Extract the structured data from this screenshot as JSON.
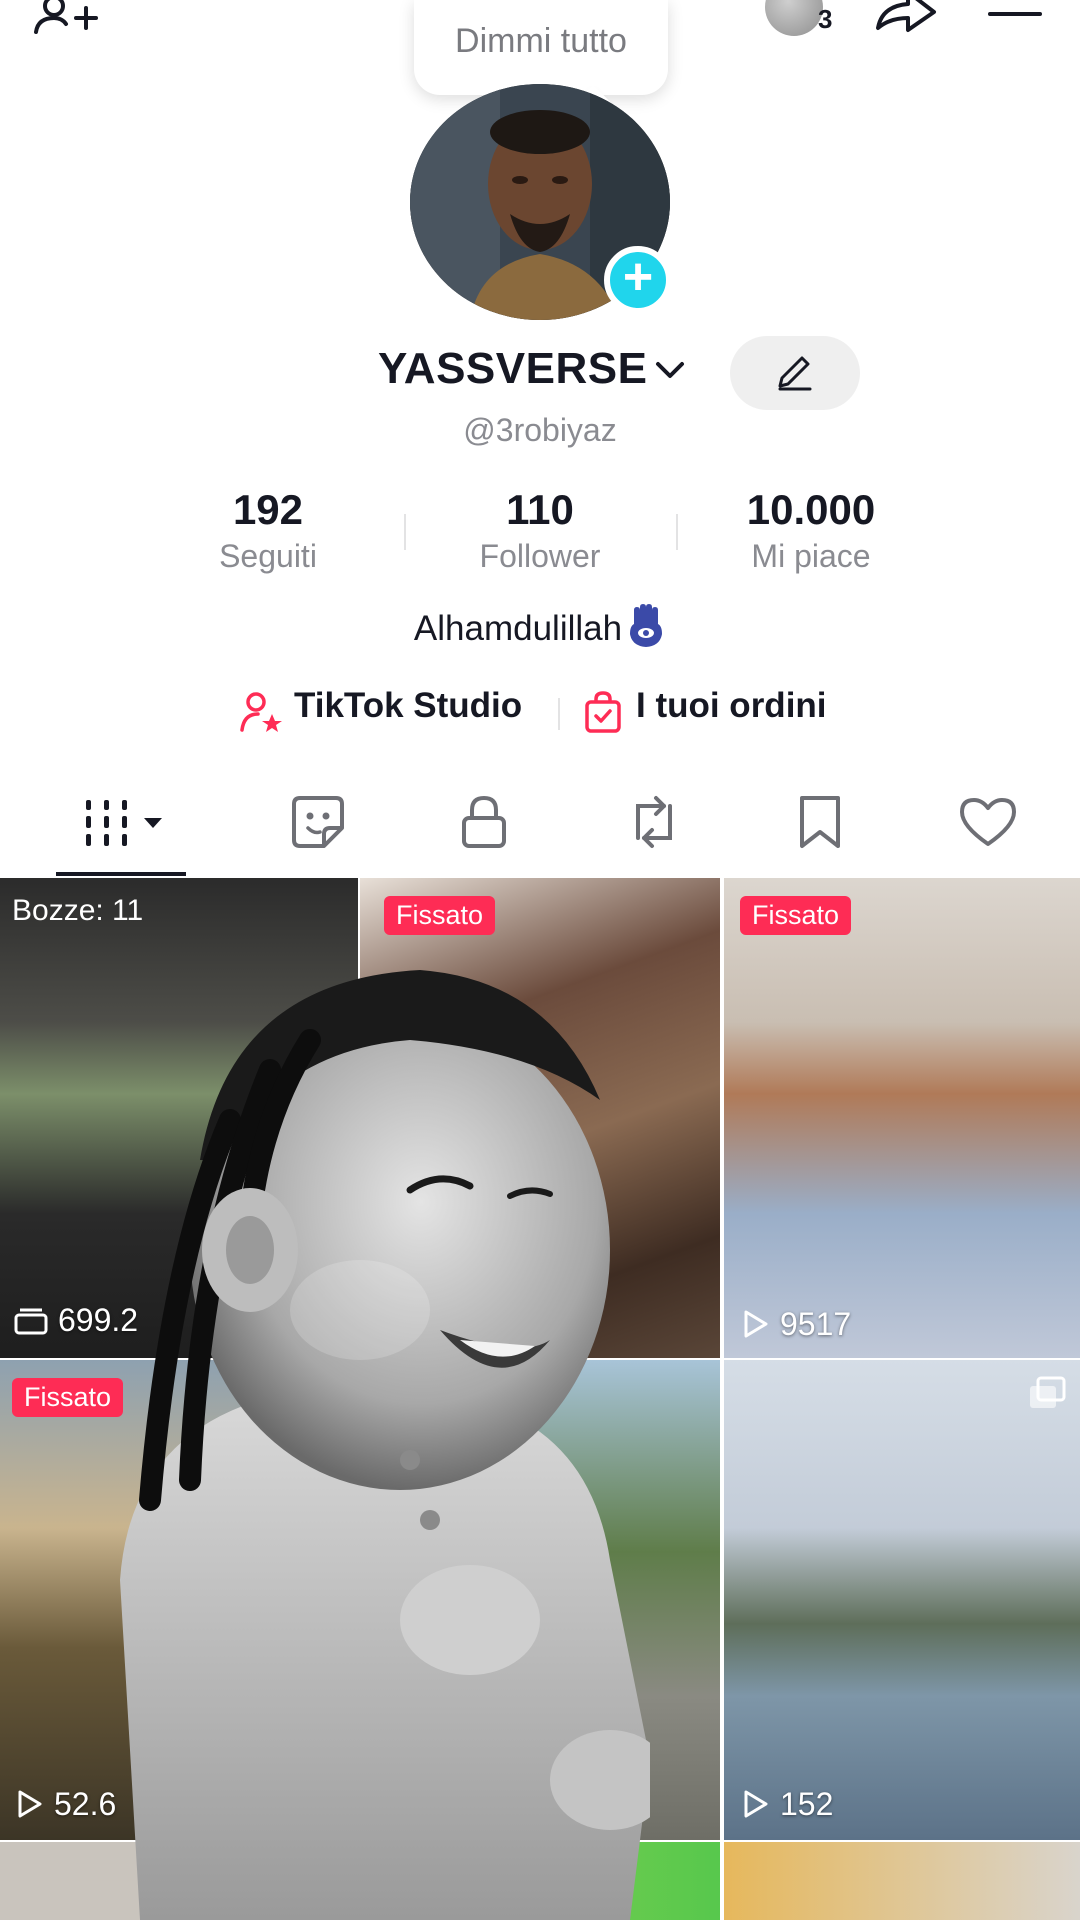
{
  "topbar": {
    "notification_count": "3"
  },
  "tooltip": {
    "text": "Dimmi tutto"
  },
  "profile": {
    "display_name": "YASSVERSE",
    "handle": "@3robiyaz",
    "bio": "Alhamdulillah"
  },
  "stats": [
    {
      "value": "192",
      "label": "Seguiti"
    },
    {
      "value": "110",
      "label": "Follower"
    },
    {
      "value": "10.000",
      "label": "Mi piace"
    }
  ],
  "links": {
    "studio": "TikTok Studio",
    "orders": "I tuoi ordini"
  },
  "tabs": [
    {
      "name": "videos"
    },
    {
      "name": "stickers"
    },
    {
      "name": "private"
    },
    {
      "name": "reposts"
    },
    {
      "name": "favorites"
    },
    {
      "name": "liked"
    }
  ],
  "grid": {
    "drafts_label": "Bozze: 11",
    "pinned_label": "Fissato",
    "cells": [
      {
        "views": "699.2"
      },
      {
        "views": ""
      },
      {
        "views": "9517"
      },
      {
        "views": "52.6"
      },
      {
        "views": ""
      },
      {
        "views": "152"
      }
    ]
  },
  "colors": {
    "accent_pink": "#fe2c55",
    "add_badge": "#20d5ec",
    "text_primary": "#161823",
    "text_secondary": "#8a8b91",
    "bio_emoji_blue": "#3b4aa8"
  }
}
